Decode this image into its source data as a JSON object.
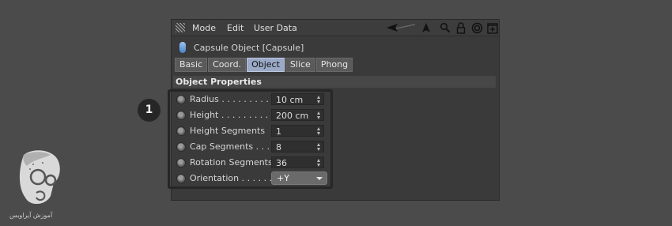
{
  "menubar": {
    "items": [
      "Mode",
      "Edit",
      "User Data"
    ],
    "icons": [
      "pointer-back-icon",
      "cursor-arrow-icon",
      "search-icon",
      "lock-icon",
      "target-icon",
      "new-panel-icon"
    ]
  },
  "object": {
    "title": "Capsule Object [Capsule]"
  },
  "tabs": [
    {
      "label": "Basic",
      "active": false
    },
    {
      "label": "Coord.",
      "active": false
    },
    {
      "label": "Object",
      "active": true
    },
    {
      "label": "Slice",
      "active": false
    },
    {
      "label": "Phong",
      "active": false
    }
  ],
  "section": {
    "title": "Object Properties"
  },
  "params": [
    {
      "label": "Radius . . . . . . . . . .",
      "value": "10 cm"
    },
    {
      "label": "Height . . . . . . . . . .",
      "value": "200 cm"
    },
    {
      "label": "Height Segments",
      "value": "1"
    },
    {
      "label": "Cap Segments . . . .",
      "value": "8"
    },
    {
      "label": "Rotation Segments",
      "value": "36"
    },
    {
      "label": "Orientation . . . . . .",
      "value": "+Y"
    }
  ],
  "annotation": {
    "step": "1"
  },
  "logo": {
    "text": "آموزش آیراوبس"
  },
  "colors": {
    "active_tab": "#9aa9c6",
    "panel_bg": "#3a3a3a",
    "page_bg": "#4b4b4b"
  }
}
